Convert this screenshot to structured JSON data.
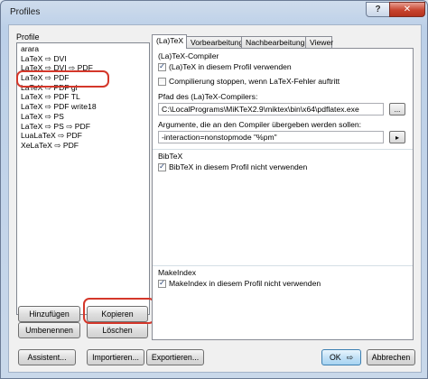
{
  "window": {
    "title": "Profiles",
    "help_label": "?",
    "close_label": "✕"
  },
  "profiles": {
    "label": "Profile",
    "items": [
      "arara",
      "LaTeX ⇨ DVI",
      "LaTeX ⇨ DVI ⇨ PDF",
      "LaTeX ⇨ PDF",
      "LaTeX ⇨ PDF gl",
      "LaTeX ⇨ PDF TL",
      "LaTeX ⇨ PDF write18",
      "LaTeX ⇨ PS",
      "LaTeX ⇨ PS ⇨ PDF",
      "LuaLaTeX ⇨ PDF",
      "XeLaTeX ⇨ PDF"
    ],
    "buttons": {
      "add": "Hinzufügen",
      "copy": "Kopieren",
      "rename": "Umbenennen",
      "delete": "Löschen"
    }
  },
  "tabs": [
    "(La)TeX",
    "Vorbearbeitung",
    "Nachbearbeitung",
    "Viewer"
  ],
  "latex_tab": {
    "compiler_group": "(La)TeX-Compiler",
    "use_in_profile": {
      "label": "(La)TeX in diesem Profil verwenden",
      "checked": true
    },
    "stop_on_error": {
      "label": "Compilierung stoppen, wenn LaTeX-Fehler auftritt",
      "checked": false
    },
    "path_label": "Pfad des (La)TeX-Compilers:",
    "path_value": "C:\\LocalPrograms\\MiKTeX2.9\\miktex\\bin\\x64\\pdflatex.exe",
    "browse_label": "...",
    "args_label": "Argumente, die an den Compiler übergeben werden sollen:",
    "args_value": "-interaction=nonstopmode \"%pm\"",
    "args_button": "▸",
    "bibtex_group": "BibTeX",
    "bibtex_unused": {
      "label": "BibTeX in diesem Profil nicht verwenden",
      "checked": true
    },
    "makeindex_group": "MakeIndex",
    "makeindex_unused": {
      "label": "MakeIndex in diesem Profil nicht verwenden",
      "checked": true
    }
  },
  "footer": {
    "assistant": "Assistent...",
    "import": "Importieren...",
    "export": "Exportieren...",
    "ok": "OK",
    "ok_arrow": "⇨",
    "cancel": "Abbrechen"
  },
  "colors": {
    "highlight": "#d4372a",
    "accent": "#3c7fb1"
  }
}
